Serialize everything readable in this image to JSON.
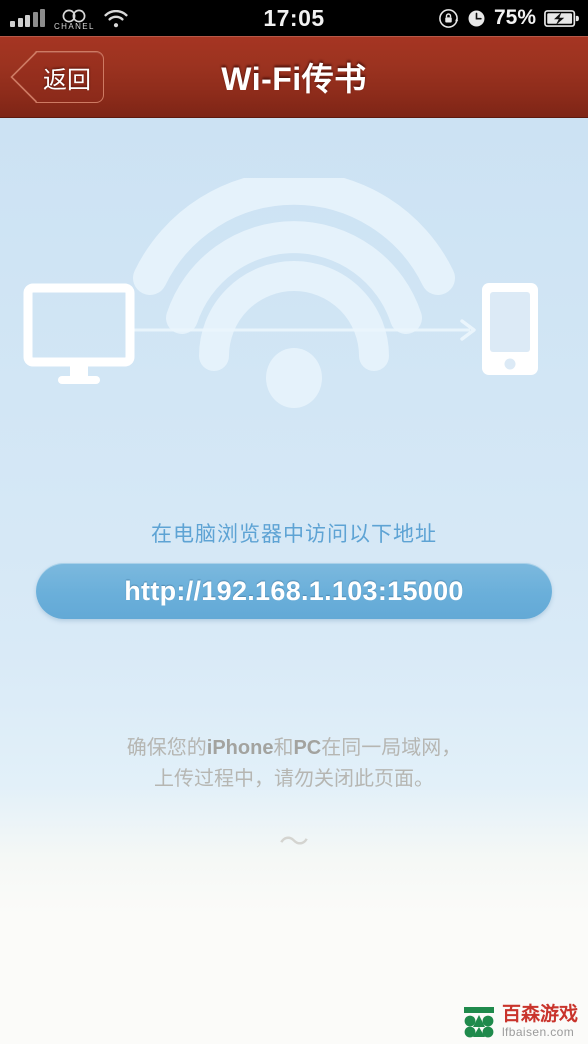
{
  "status_bar": {
    "carrier": "CHANEL",
    "signal_icon": "signal-bars-icon",
    "wifi_icon": "wifi-icon",
    "time": "17:05",
    "rotation_lock_icon": "rotation-lock-icon",
    "alarm_icon": "alarm-clock-icon",
    "battery_percent": "75%",
    "battery_icon": "battery-charging-icon"
  },
  "nav_bar": {
    "back_label": "返回",
    "title": "Wi-Fi传书",
    "bg_color": "#9c3320"
  },
  "illustration": {
    "computer_icon": "desktop-monitor-icon",
    "wifi_signal_icon": "wifi-waves-icon",
    "arrow_icon": "arrow-right-icon",
    "phone_icon": "smartphone-icon"
  },
  "main": {
    "instruction": "在电脑浏览器中访问以下地址",
    "url": "http://192.168.1.103:15000",
    "url_pill_color": "#6aafda",
    "hint_line1_a": "确保您的",
    "hint_line1_b": "iPhone",
    "hint_line1_c": "和",
    "hint_line1_d": "PC",
    "hint_line1_e": "在同一局域网，",
    "hint_line2": "上传过程中，请勿关闭此页面。",
    "wave_glyph": "〜"
  },
  "watermark": {
    "logo_icon": "baisen-logo-icon",
    "name": "百森游戏",
    "site": "lfbaisen.com",
    "name_color": "#c9342c"
  }
}
